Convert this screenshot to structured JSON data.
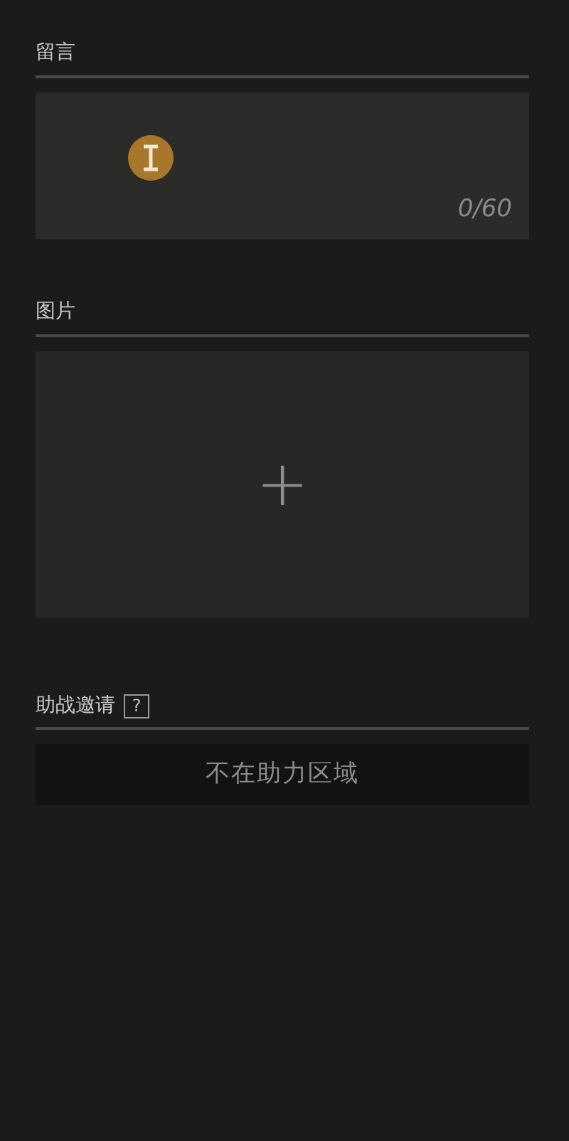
{
  "message": {
    "label": "留言",
    "counter": "0/60"
  },
  "image": {
    "label": "图片",
    "add_symbol": "+"
  },
  "assist": {
    "label": "助战邀请",
    "help_symbol": "?",
    "button": {
      "label": "不在助力区域",
      "disabled": true
    }
  }
}
